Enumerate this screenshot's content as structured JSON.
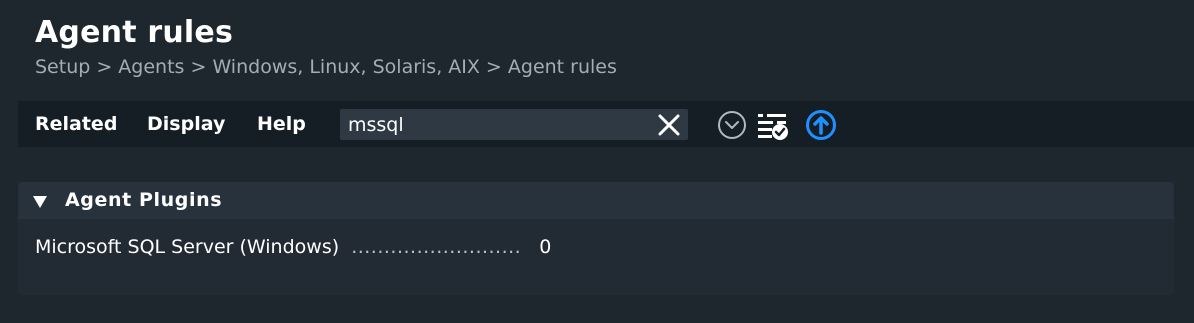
{
  "page": {
    "title": "Agent rules",
    "breadcrumb": "Setup > Agents > Windows, Linux, Solaris, AIX > Agent rules"
  },
  "menubar": {
    "related": "Related",
    "display": "Display",
    "help": "Help",
    "search": {
      "value": "mssql",
      "placeholder": ""
    },
    "icons": [
      "clear-icon",
      "toggle-down-icon",
      "rule-list-check-icon",
      "upload-icon"
    ]
  },
  "section": {
    "title": "Agent Plugins",
    "rules": [
      {
        "label": "Microsoft SQL Server (Windows)",
        "dots": "..........................",
        "count": "0"
      }
    ]
  },
  "colors": {
    "background": "#1e262e",
    "menubar": "#151d25",
    "search_bg": "#2e3944",
    "panel": "#222b34",
    "panel_header": "#28323c",
    "accent_blue": "#1e90ff",
    "muted_text": "#a4adb6"
  }
}
